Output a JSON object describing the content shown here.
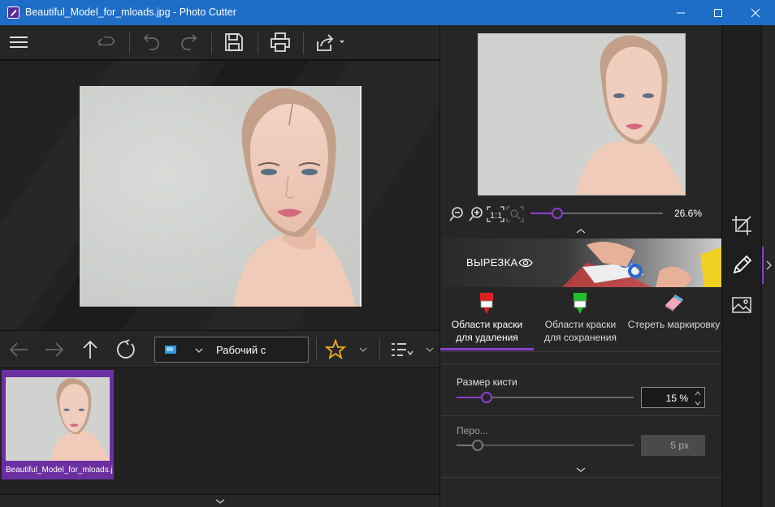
{
  "window": {
    "title": "Beautiful_Model_for_mloads.jpg - Photo Cutter",
    "accent": "#1e6ec8",
    "brand": "#8a3fd0"
  },
  "toolbar": {
    "buttons": [
      "menu-icon",
      "undo-icon",
      "redo-back-icon",
      "redo-icon",
      "save-icon",
      "print-icon",
      "share-icon"
    ]
  },
  "navigation": {
    "folder_label": "Рабочий с",
    "buttons": [
      "back-arrow-icon",
      "forward-arrow-icon",
      "up-arrow-icon",
      "refresh-icon",
      "star-icon",
      "sort-icon"
    ]
  },
  "thumbnails": [
    {
      "caption": "Beautiful_Model_for_mloads.jpg"
    }
  ],
  "preview": {
    "zoom_label": "26.6%",
    "zoom_fraction": 0.2
  },
  "banner": {
    "label": "ВЫРЕЗКА"
  },
  "tools": [
    {
      "label_line1": "Области краски",
      "label_line2": "для удаления",
      "color": "#e02020",
      "active": true
    },
    {
      "label_line1": "Области краски",
      "label_line2": "для сохранения",
      "color": "#20c030",
      "active": false
    },
    {
      "label_line1": "Стереть маркировку",
      "label_line2": "",
      "color": "#f0a0b0",
      "active": false
    }
  ],
  "brush": {
    "label": "Размер кисти",
    "value": "15 %",
    "fraction": 0.17
  },
  "feather": {
    "label": "Перо...",
    "value": "5 px",
    "fraction": 0.12
  }
}
